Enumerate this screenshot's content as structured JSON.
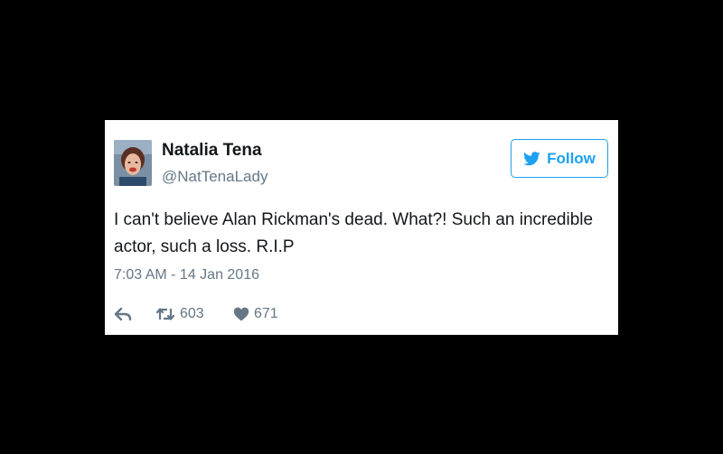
{
  "tweet": {
    "author_name": "Natalia Tena",
    "handle": "@NatTenaLady",
    "follow_label": "Follow",
    "text": "I can't believe Alan Rickman's dead. What?! Such an incredible actor, such a loss. R.I.P",
    "timestamp": "7:03 AM - 14 Jan 2016",
    "retweet_count": "603",
    "like_count": "671"
  },
  "icons": {
    "follow": "twitter-bird-icon",
    "reply": "reply-icon",
    "retweet": "retweet-icon",
    "like": "heart-icon"
  },
  "colors": {
    "accent": "#1da1f2",
    "muted": "#657786",
    "text": "#14171a",
    "background": "#000000",
    "card": "#ffffff"
  }
}
